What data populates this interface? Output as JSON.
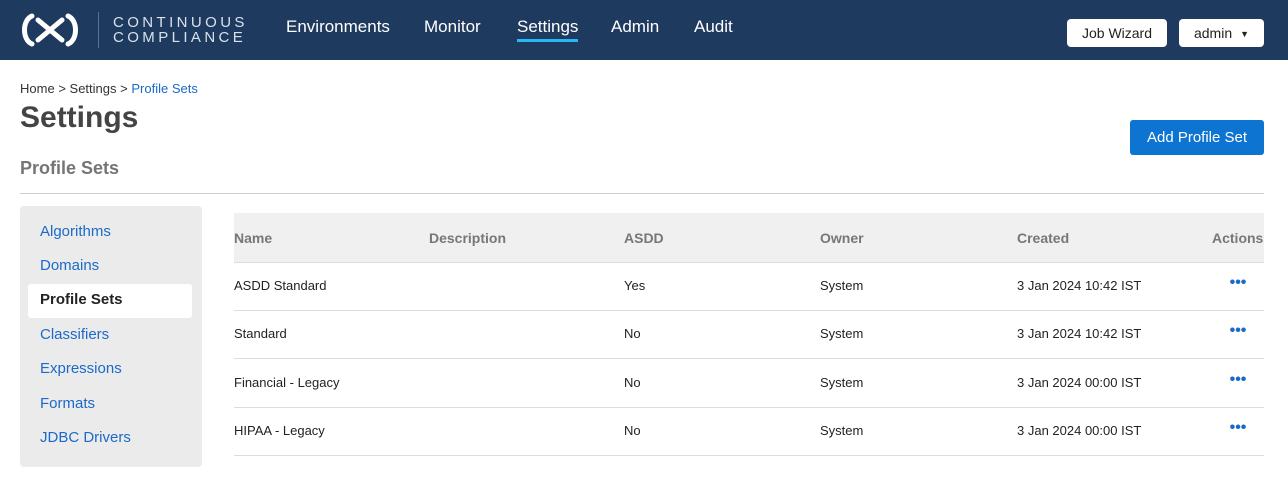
{
  "brand": {
    "line1": "CONTINUOUS",
    "line2": "COMPLIANCE"
  },
  "nav": {
    "items": [
      {
        "label": "Environments",
        "active": false
      },
      {
        "label": "Monitor",
        "active": false
      },
      {
        "label": "Settings",
        "active": true
      },
      {
        "label": "Admin",
        "active": false
      },
      {
        "label": "Audit",
        "active": false
      }
    ],
    "job_wizard_label": "Job Wizard",
    "user_label": "admin"
  },
  "breadcrumb": {
    "home": "Home",
    "settings": "Settings",
    "current": "Profile Sets",
    "sep": ">"
  },
  "page_title": "Settings",
  "section_title": "Profile Sets",
  "add_button_label": "Add Profile Set",
  "sidebar": {
    "items": [
      {
        "label": "Algorithms",
        "active": false
      },
      {
        "label": "Domains",
        "active": false
      },
      {
        "label": "Profile Sets",
        "active": true
      },
      {
        "label": "Classifiers",
        "active": false
      },
      {
        "label": "Expressions",
        "active": false
      },
      {
        "label": "Formats",
        "active": false
      },
      {
        "label": "JDBC Drivers",
        "active": false
      }
    ]
  },
  "table": {
    "headers": [
      "Name",
      "Description",
      "ASDD",
      "Owner",
      "Created",
      "Actions"
    ],
    "rows": [
      {
        "name": "ASDD Standard",
        "description": "",
        "asdd": "Yes",
        "owner": "System",
        "created": "3 Jan 2024 10:42 IST",
        "actions": "•••"
      },
      {
        "name": "Standard",
        "description": "",
        "asdd": "No",
        "owner": "System",
        "created": "3 Jan 2024 10:42 IST",
        "actions": "•••"
      },
      {
        "name": "Financial - Legacy",
        "description": "",
        "asdd": "No",
        "owner": "System",
        "created": "3 Jan 2024 00:00 IST",
        "actions": "•••"
      },
      {
        "name": "HIPAA - Legacy",
        "description": "",
        "asdd": "No",
        "owner": "System",
        "created": "3 Jan 2024 00:00 IST",
        "actions": "•••"
      }
    ]
  },
  "colors": {
    "topbar": "#1f3a5f",
    "accent_underline": "#29b6f6",
    "link": "#1b6ac9",
    "primary_button": "#0d74d1"
  }
}
